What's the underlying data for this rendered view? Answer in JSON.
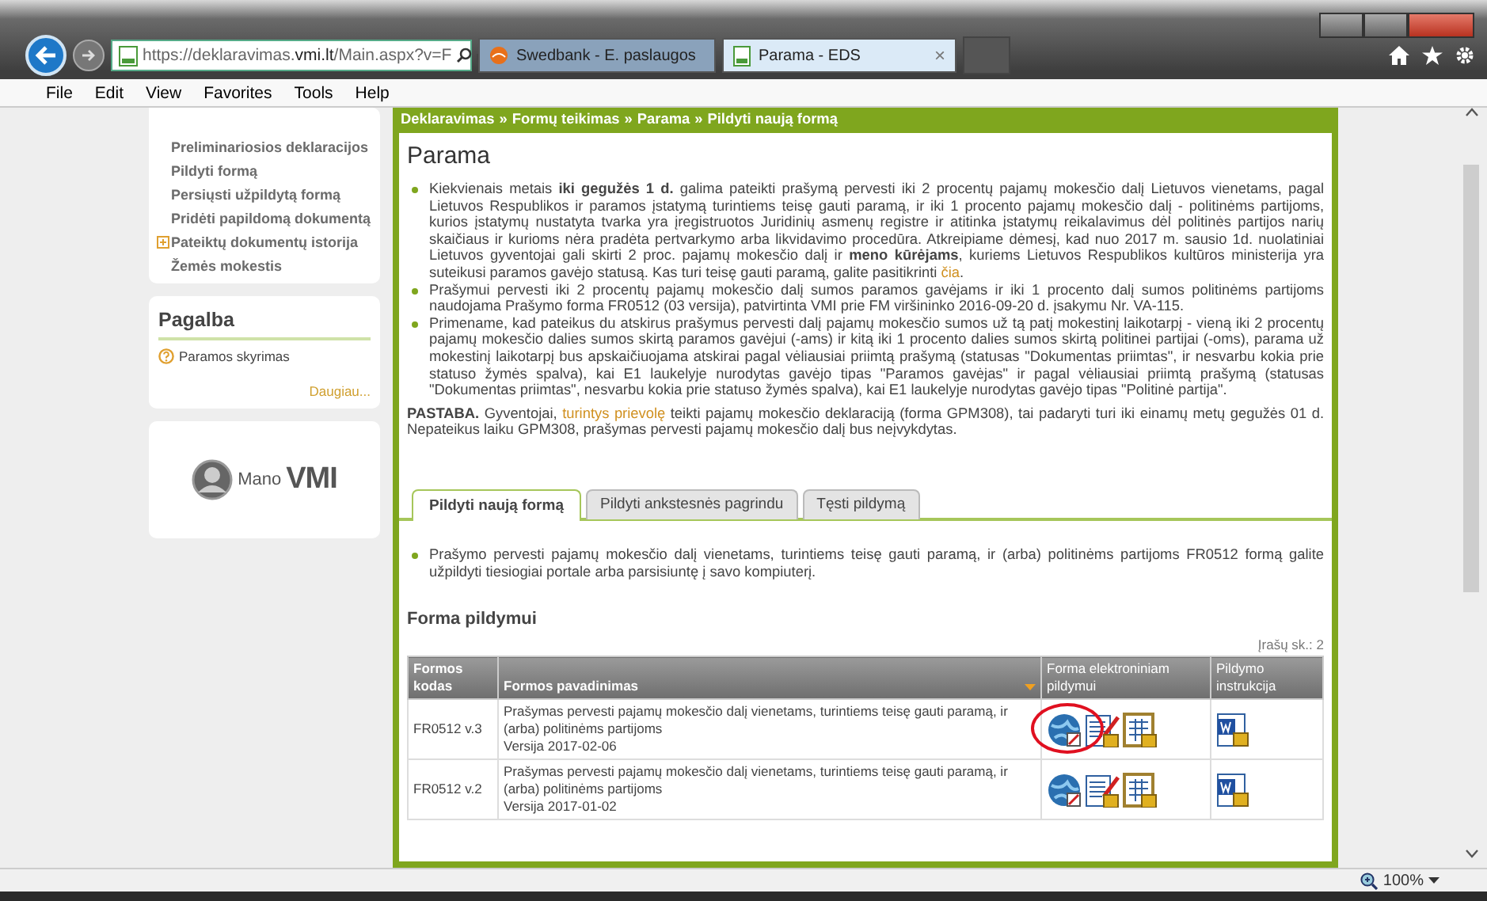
{
  "browser": {
    "address": {
      "host_prefix": "https://deklaravimas.",
      "host": "vmi.lt",
      "path": "/Main.aspx?v=F"
    },
    "tabs": [
      {
        "title": "Swedbank - E. paslaugos",
        "selected": false,
        "kind": "bank"
      },
      {
        "title": "Parama - EDS",
        "selected": true,
        "kind": "doc"
      }
    ],
    "close_tab": "×",
    "menu": [
      "File",
      "Edit",
      "View",
      "Favorites",
      "Tools",
      "Help"
    ],
    "zoom": "100%"
  },
  "sidebar": {
    "nav": [
      {
        "label": "Preliminariosios deklaracijos",
        "expandable": false
      },
      {
        "label": "Pildyti formą",
        "expandable": false
      },
      {
        "label": "Persiųsti užpildytą formą",
        "expandable": false
      },
      {
        "label": "Pridėti papildomą dokumentą",
        "expandable": false
      },
      {
        "label": "Pateiktų dokumentų istorija",
        "expandable": true
      },
      {
        "label": "Žemės mokestis",
        "expandable": false
      }
    ],
    "help": {
      "title": "Pagalba",
      "items": [
        "Paramos skyrimas"
      ],
      "more": "Daugiau..."
    },
    "logo": {
      "prefix": "Mano",
      "name": "VMI"
    }
  },
  "main": {
    "breadcrumb": [
      "Deklaravimas",
      "Formų teikimas",
      "Parama",
      "Pildyti naują formą"
    ],
    "breadcrumb_separator": "»",
    "title": "Parama",
    "bullets": [
      [
        {
          "kind": "text",
          "text": "Kiekvienais metais "
        },
        {
          "kind": "bold",
          "text": "iki gegužės 1 d."
        },
        {
          "kind": "text",
          "text": " galima pateikti prašymą pervesti iki 2 procentų pajamų mokesčio dalį Lietuvos vienetams, pagal Lietuvos Respublikos ir paramos įstatymą turintiems teisę gauti paramą, ir iki 1 procento pajamų mokesčio dalį - politinėms partijoms, kurios įstatymų nustatyta tvarka yra įregistruotos Juridinių asmenų registre ir atitinka įstatymų reikalavimus dėl politinės partijos narių skaičiaus ir kurioms nėra pradėta pertvarkymo arba likvidavimo procedūra. Atkreipiame dėmesį, kad nuo 2017 m. sausio 1d. nuolatiniai Lietuvos gyventojai gali skirti 2 proc. pajamų mokesčio dalį ir "
        },
        {
          "kind": "bold",
          "text": "meno kūrėjams"
        },
        {
          "kind": "text",
          "text": ", kuriems Lietuvos Respublikos kultūros ministerija yra suteikusi paramos gavėjo statusą.  Kas turi teisę gauti paramą, galite pasitikrinti "
        },
        {
          "kind": "link",
          "text": "čia"
        },
        {
          "kind": "text",
          "text": "."
        }
      ],
      [
        {
          "kind": "text",
          "text": "Prašymui pervesti iki 2 procentų pajamų mokesčio dalį sumos paramos gavėjams ir iki 1 procento dalį sumos politinėms partijoms naudojama Prašymo forma FR0512 (03 versija), patvirtinta VMI prie FM viršininko 2016-09-20 d. įsakymu Nr. VA-115."
        }
      ],
      [
        {
          "kind": "text",
          "text": "Primename, kad pateikus du atskirus prašymus pervesti dalį pajamų mokesčio sumos už tą patį mokestinį laikotarpį - vieną iki 2 procentų pajamų mokesčio dalies sumos skirtą paramos gavėjui (-ams) ir kitą iki 1 procento dalies sumos skirtą politinei partijai (-oms), parama už mokestinį laikotarpį bus apskaičiuojama atskirai pagal vėliausiai priimtą prašymą (statusas \"Dokumentas priimtas\", ir nesvarbu kokia prie statuso žymės spalva), kai E1 laukelyje nurodytas gavėjo tipas \"Paramos gavėjas\" ir pagal vėliausiai priimtą prašymą (statusas \"Dokumentas priimtas\", nesvarbu kokia prie statuso žymės spalva), kai E1 laukelyje nurodytas gavėjo tipas \"Politinė partija\"."
        }
      ]
    ],
    "note": [
      {
        "kind": "bold",
        "text": "PASTABA."
      },
      {
        "kind": "text",
        "text": " Gyventojai, "
      },
      {
        "kind": "link",
        "text": "turintys prievolę"
      },
      {
        "kind": "text",
        "text": " teikti pajamų mokesčio deklaraciją (forma GPM308), tai padaryti turi iki einamų metų gegužės 01 d. Nepateikus laiku GPM308, prašymas pervesti pajamų mokesčio dalį bus neįvykdytas."
      }
    ],
    "tabs": [
      {
        "label": "Pildyti naują formą",
        "selected": true
      },
      {
        "label": "Pildyti ankstesnės pagrindu",
        "selected": false
      },
      {
        "label": "Tęsti pildymą",
        "selected": false
      }
    ],
    "tab_bullets": [
      "Prašymo pervesti pajamų mokesčio dalį vienetams, turintiems teisę gauti paramą, ir (arba) politinėms partijoms FR0512 formą galite užpildyti tiesiogiai portale arba parsisiuntę į savo kompiuterį."
    ],
    "section_title": "Forma pildymui",
    "record_count": "Įrašų sk.: 2",
    "table": {
      "columns": [
        {
          "label": "Formos kodas",
          "sortable": false
        },
        {
          "label": "Formos pavadinimas",
          "sortable": true
        },
        {
          "label": "Forma elektroniniam pildymui",
          "sortable": false
        },
        {
          "label": "Pildymo instrukcija",
          "sortable": false
        }
      ],
      "rows": [
        {
          "code": "FR0512 v.3",
          "name": "Prašymas pervesti pajamų mokesčio dalį vienetams, turintiems teisę gauti paramą, ir (arba) politinėms partijoms",
          "version": "Versija 2017-02-06",
          "circled": true
        },
        {
          "code": "FR0512 v.2",
          "name": "Prašymas pervesti pajamų mokesčio dalį vienetams, turintiems teisę gauti paramą, ir (arba) politinėms partijoms",
          "version": "Versija 2017-01-02",
          "circled": false
        }
      ]
    }
  }
}
